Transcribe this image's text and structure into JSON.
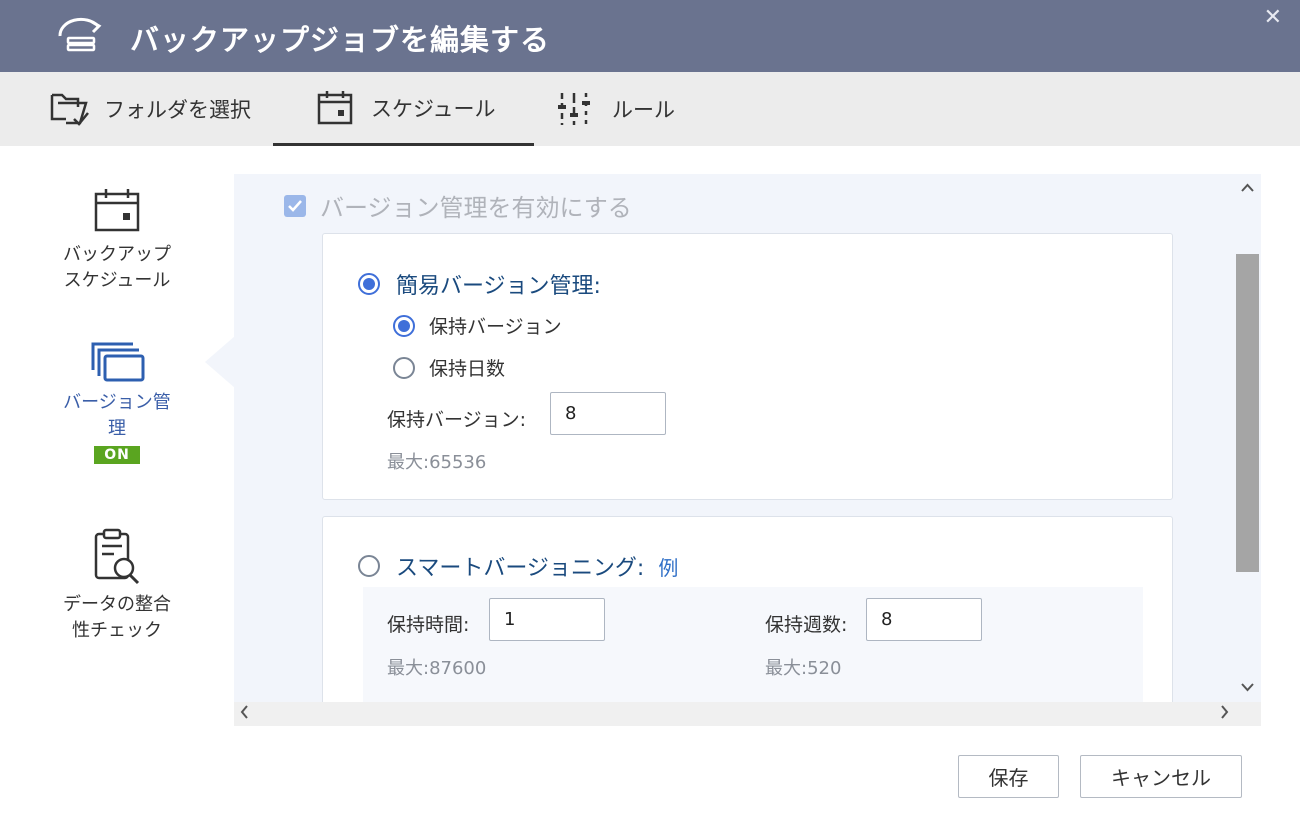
{
  "window": {
    "title": "バックアップジョブを編集する",
    "close_glyph": "✕"
  },
  "tabs": [
    {
      "label": "フォルダを選択",
      "icon": "folder-check-icon"
    },
    {
      "label": "スケジュール",
      "icon": "calendar-icon",
      "selected": true
    },
    {
      "label": "ルール",
      "icon": "sliders-icon"
    }
  ],
  "sidebar": {
    "items": [
      {
        "label": "バックアップ\nスケジュール",
        "icon": "calendar-icon"
      },
      {
        "label": "バージョン管\n理",
        "icon": "versions-icon",
        "badge": "ON",
        "active": true
      },
      {
        "label": "データの整合\n性チェック",
        "icon": "document-search-icon"
      }
    ]
  },
  "versioning": {
    "enable_label": "バージョン管理を有効にする",
    "enabled": true,
    "simple": {
      "label": "簡易バージョン管理:",
      "selected": true,
      "option_versions": "保持バージョン",
      "option_days": "保持日数",
      "selected_option": "保持バージョン",
      "field_label": "保持バージョン:",
      "field_value": "8",
      "max_hint": "最大:65536"
    },
    "smart": {
      "label": "スマートバージョニング:",
      "example_link": "例",
      "selected": false,
      "hours_label": "保持時間:",
      "hours_value": "1",
      "hours_max": "最大:87600",
      "weeks_label": "保持週数:",
      "weeks_value": "8",
      "weeks_max": "最大:520"
    }
  },
  "scroll": {
    "up": "^",
    "down": "v",
    "left": "<",
    "right": ">"
  },
  "footer": {
    "save_label": "保存",
    "cancel_label": "キャンセル"
  },
  "colors": {
    "titlebar": "#6a738f",
    "accent": "#3f6fd9",
    "badge_on": "#5aa520",
    "link": "#2f6fc7"
  }
}
